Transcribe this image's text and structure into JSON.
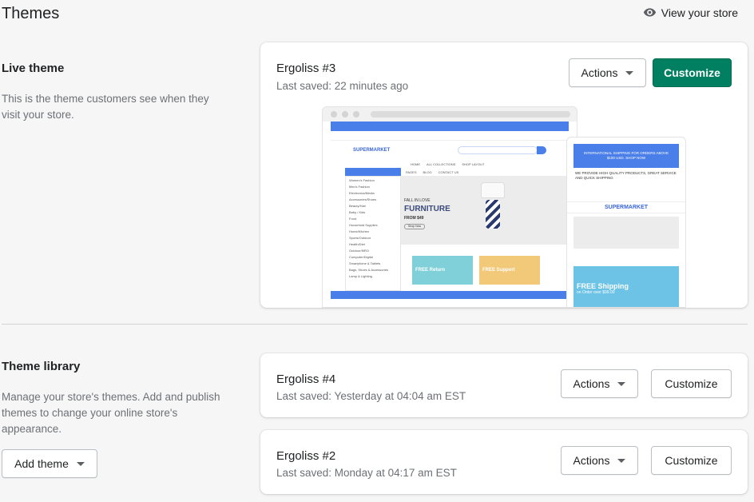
{
  "page": {
    "title": "Themes",
    "view_store_label": "View your store"
  },
  "live": {
    "section_title": "Live theme",
    "section_desc": "This is the theme customers see when they visit your store.",
    "theme_name": "Ergoliss #3",
    "last_saved": "Last saved: 22 minutes ago",
    "actions_label": "Actions",
    "customize_label": "Customize"
  },
  "preview": {
    "brand": "SUPERMARKET",
    "hero_line1": "FALL IN LOVE",
    "hero_line2": "FURNITURE",
    "hero_price": "FROM $49",
    "shop_now": "Shop Now",
    "categories_header": "ALL COLLECTIONS",
    "nav_items": [
      "HOME",
      "ALL COLLECTIONS",
      "SHOP LAYOUT",
      "PAGES",
      "BLOG",
      "CONTACT US"
    ],
    "categories": [
      "Women's Fashion",
      "Men's Fashion",
      "Electronics/Media",
      "Accessories/Shoes",
      "Beauty/Hair",
      "Baby / Kids",
      "Food",
      "Household Supplies",
      "Home/Kitchen",
      "Sports/Outdoor",
      "Health/Diet",
      "Outdoor/MRO",
      "Computer/Digital",
      "Smartphone & Tablets",
      "Bags, Shoes & Accessories",
      "Lamp & Lighting"
    ],
    "free_returns": "FREE Return",
    "free_support": "FREE Support",
    "mobile_banner": "INTERNATIONAL SHIPPING FOR ORDERS ABOVE $100 USD. SHOP NOW",
    "mobile_promo": "WE PROVIDE HIGH QUALITY PRODUCTS, GREAT SERVICE AND QUICK SHIPPING",
    "mobile_free_shipping": "FREE Shipping",
    "mobile_free_sub": "on Order over $99.00"
  },
  "library": {
    "section_title": "Theme library",
    "section_desc": "Manage your store's themes. Add and publish themes to change your online store's appearance.",
    "add_theme_label": "Add theme",
    "themes": [
      {
        "name": "Ergoliss #4",
        "last_saved": "Last saved: Yesterday at 04:04 am EST",
        "actions_label": "Actions",
        "customize_label": "Customize"
      },
      {
        "name": "Ergoliss #2",
        "last_saved": "Last saved: Monday at 04:17 am EST",
        "actions_label": "Actions",
        "customize_label": "Customize"
      }
    ]
  },
  "colors": {
    "primary": "#008060",
    "accent_blue": "#4a7ee8"
  },
  "icons": {
    "view_store": "eye-icon",
    "dropdown": "caret-down-icon"
  }
}
